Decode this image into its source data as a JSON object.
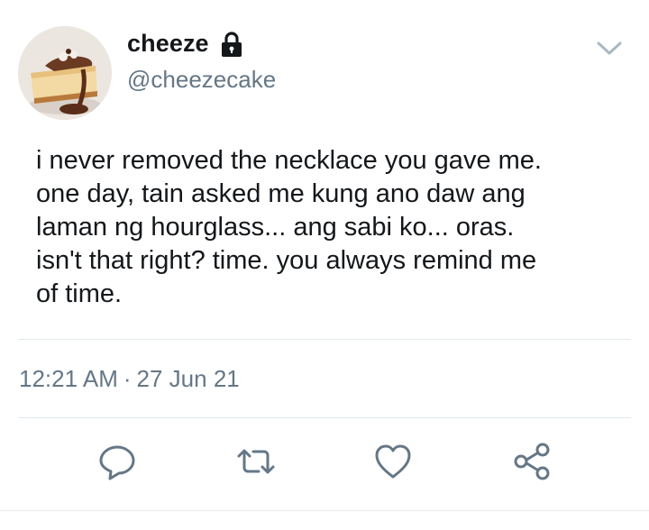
{
  "tweet": {
    "display_name": "cheeze",
    "handle": "@cheezecake",
    "protected_icon": "lock-icon",
    "menu_icon": "chevron-down-icon",
    "avatar_icon": "cheesecake-avatar",
    "text": "i never removed the necklace you gave me.\none day, tain asked me kung ano daw ang\nlaman ng hourglass... ang sabi ko... oras.\nisn't that right? time. you always remind me\nof time.",
    "time": "12:21 AM",
    "separator": "·",
    "date": "27 Jun 21"
  },
  "actions": [
    {
      "name": "reply",
      "icon": "reply-icon"
    },
    {
      "name": "retweet",
      "icon": "retweet-icon"
    },
    {
      "name": "like",
      "icon": "heart-icon"
    },
    {
      "name": "share",
      "icon": "share-icon"
    }
  ],
  "colors": {
    "text": "#14171a",
    "secondary": "#657786",
    "divider": "#e1e8ed",
    "icon": "#657786"
  }
}
